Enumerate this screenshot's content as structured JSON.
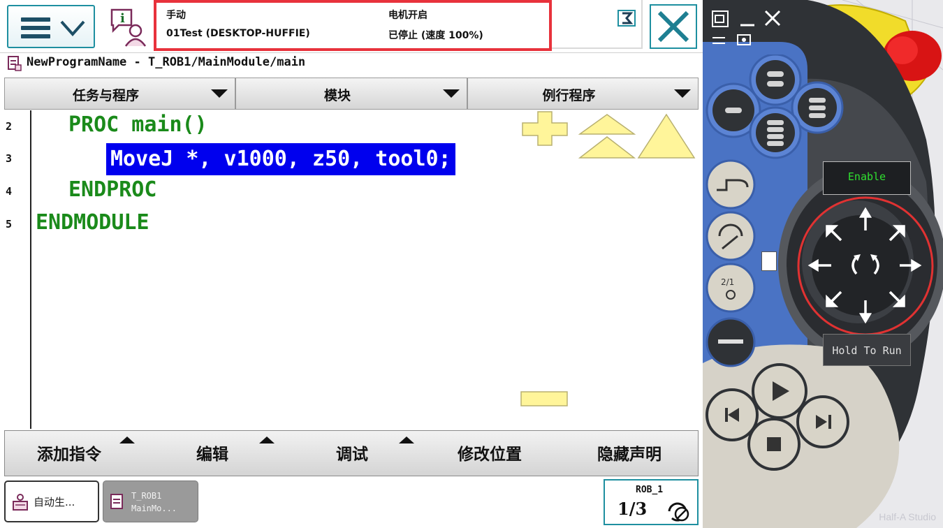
{
  "topbar": {
    "mode": "手动",
    "motor": "电机开启",
    "controller": "01Test (DESKTOP-HUFFIE)",
    "run_state": "已停止 (速度 100%)"
  },
  "path": "NewProgramName - T_ROB1/MainModule/main",
  "tabs": [
    {
      "label": "任务与程序"
    },
    {
      "label": "模块"
    },
    {
      "label": "例行程序"
    }
  ],
  "code_lines": [
    {
      "num": "2",
      "text": "PROC main()"
    },
    {
      "num": "3",
      "text": "MoveJ *, v1000, z50, tool0;"
    },
    {
      "num": "4",
      "text": "ENDPROC"
    },
    {
      "num": "5",
      "text": "ENDMODULE"
    }
  ],
  "bottom_menu": [
    {
      "label": "添加指令"
    },
    {
      "label": "编辑"
    },
    {
      "label": "调试"
    },
    {
      "label": "修改位置"
    },
    {
      "label": "隐藏声明"
    }
  ],
  "taskbar": {
    "task1": "自动生...",
    "task2_line1": "T_ROB1",
    "task2_line2": "MainMo...",
    "rob_label": "ROB_1",
    "rob_fraction": "1/3"
  },
  "pendant": {
    "enable_label": "Enable",
    "hold_to_run_label": "Hold To Run",
    "watermark": "Half-A Studio"
  },
  "colors": {
    "code_green": "#1a8a1a",
    "selection_blue": "#0000ee",
    "highlight_red": "#e8323c",
    "frame_teal": "#1e8fa0",
    "pendant_blue": "#4a73c4",
    "pendant_dark": "#3a3a3e",
    "zoom_yellow": "#fff59a"
  }
}
